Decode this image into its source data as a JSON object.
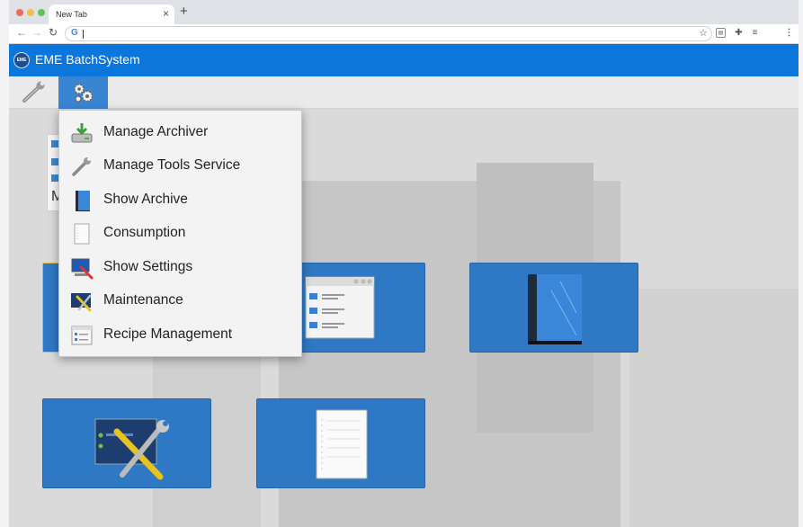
{
  "browser": {
    "tab_title": "New Tab",
    "tab_close": "×",
    "new_tab": "+",
    "address_value": "",
    "google_glyph": "G"
  },
  "app": {
    "title": "EME BatchSystem",
    "logo_text": "EME",
    "accent_color": "#0b76dc",
    "toolbar": [
      {
        "icon": "wrench-icon",
        "active": false
      },
      {
        "icon": "gears-icon",
        "active": true
      }
    ]
  },
  "menu": {
    "items": [
      {
        "label": "Manage Archiver",
        "icon": "archive-drive-icon"
      },
      {
        "label": "Manage Tools Service",
        "icon": "wrench-icon"
      },
      {
        "label": "Show Archive",
        "icon": "book-icon"
      },
      {
        "label": "Consumption",
        "icon": "document-icon"
      },
      {
        "label": "Show Settings",
        "icon": "settings-monitor-icon"
      },
      {
        "label": "Maintenance",
        "icon": "maintenance-icon"
      },
      {
        "label": "Recipe Management",
        "icon": "recipe-list-icon"
      }
    ]
  },
  "background": {
    "partial_card_letter": "M"
  },
  "tiles": [
    {
      "icon": "partially-hidden-tile"
    },
    {
      "icon": "recipe-window-icon"
    },
    {
      "icon": "book-icon"
    },
    {
      "icon": "maintenance-icon"
    },
    {
      "icon": "document-icon"
    }
  ]
}
